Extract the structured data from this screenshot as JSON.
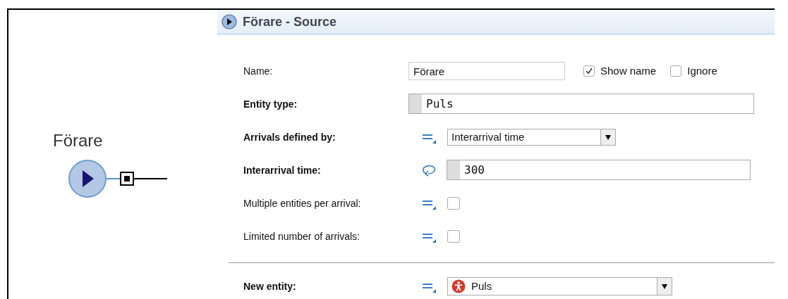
{
  "canvas": {
    "node": {
      "label": "Förare"
    }
  },
  "panel": {
    "title": "Förare - Source",
    "rows": [
      {
        "kind": "name",
        "label": "Name:",
        "bold": false,
        "value": "Förare",
        "options": [
          {
            "label": "Show name",
            "checked": true
          },
          {
            "label": "Ignore",
            "checked": false
          }
        ]
      },
      {
        "kind": "code",
        "label": "Entity type:",
        "bold": true,
        "value": "Puls"
      },
      {
        "kind": "select",
        "label": "Arrivals defined by:",
        "bold": true,
        "value": "Interarrival time"
      },
      {
        "kind": "expr",
        "label": "Interarrival time:",
        "bold": true,
        "value": "300"
      },
      {
        "kind": "checkbox",
        "label": "Multiple entities per arrival:",
        "bold": false,
        "checked": false
      },
      {
        "kind": "checkbox",
        "label": "Limited number of arrivals:",
        "bold": false,
        "checked": false
      },
      {
        "kind": "divider"
      },
      {
        "kind": "entity",
        "label": "New entity:",
        "bold": true,
        "value": "Puls"
      }
    ]
  }
}
